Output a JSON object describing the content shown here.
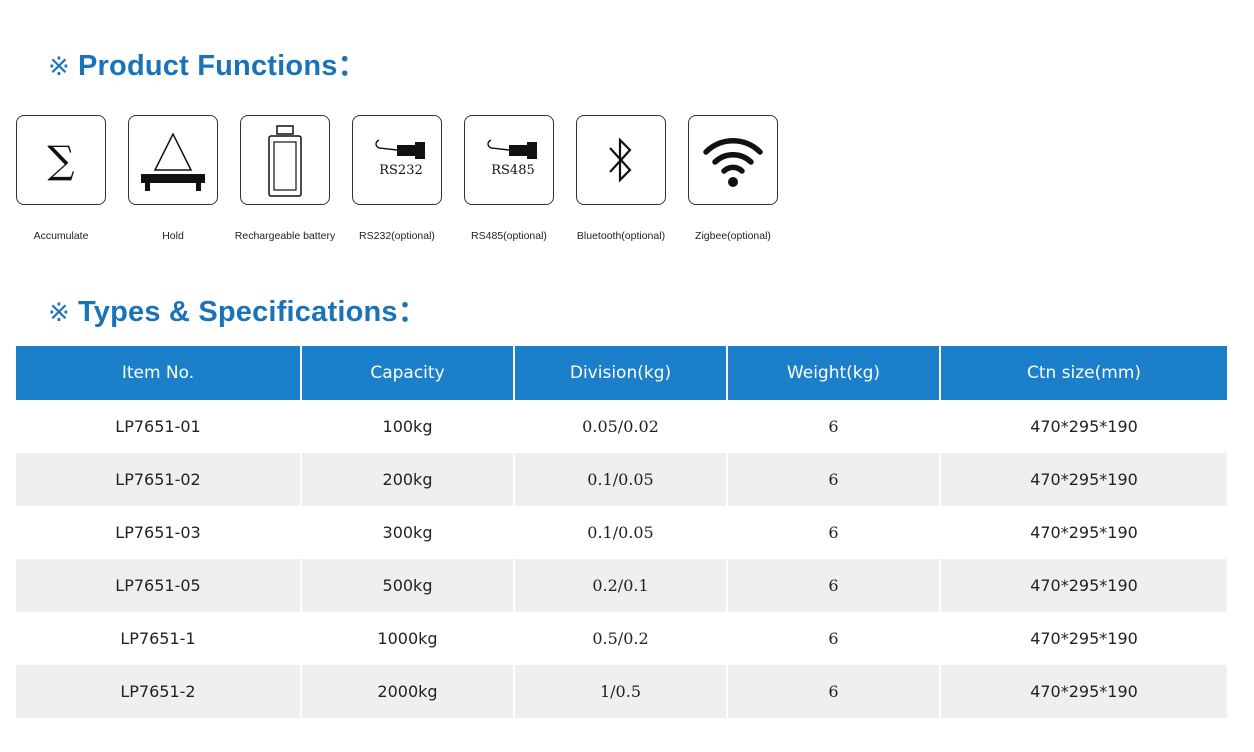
{
  "functions": {
    "mark": "※",
    "title": "Product Functions：",
    "items": [
      {
        "icon": "sigma-icon",
        "label": "Accumulate"
      },
      {
        "icon": "scale-hold-icon",
        "label": "Hold"
      },
      {
        "icon": "battery-icon",
        "label": "Rechargeable battery"
      },
      {
        "icon": "rs232-cable-icon",
        "label": "RS232(optional)",
        "icon_text": "RS232"
      },
      {
        "icon": "rs485-cable-icon",
        "label": "RS485(optional)",
        "icon_text": "RS485"
      },
      {
        "icon": "bluetooth-icon",
        "label": "Bluetooth(optional)"
      },
      {
        "icon": "wifi-icon",
        "label": "Zigbee(optional)"
      }
    ]
  },
  "specs": {
    "mark": "※",
    "title": "Types & Specifications：",
    "header_color": "#1b7fc9",
    "columns": [
      "Item No.",
      "Capacity",
      "Division(kg)",
      "Weight(kg)",
      "Ctn size(mm)"
    ],
    "rows": [
      [
        "LP7651-01",
        "100kg",
        "0.05/0.02",
        "6",
        "470*295*190"
      ],
      [
        "LP7651-02",
        "200kg",
        "0.1/0.05",
        "6",
        "470*295*190"
      ],
      [
        "LP7651-03",
        "300kg",
        "0.1/0.05",
        "6",
        "470*295*190"
      ],
      [
        "LP7651-05",
        "500kg",
        "0.2/0.1",
        "6",
        "470*295*190"
      ],
      [
        "LP7651-1",
        "1000kg",
        "0.5/0.2",
        "6",
        "470*295*190"
      ],
      [
        "LP7651-2",
        "2000kg",
        "1/0.5",
        "6",
        "470*295*190"
      ]
    ]
  }
}
